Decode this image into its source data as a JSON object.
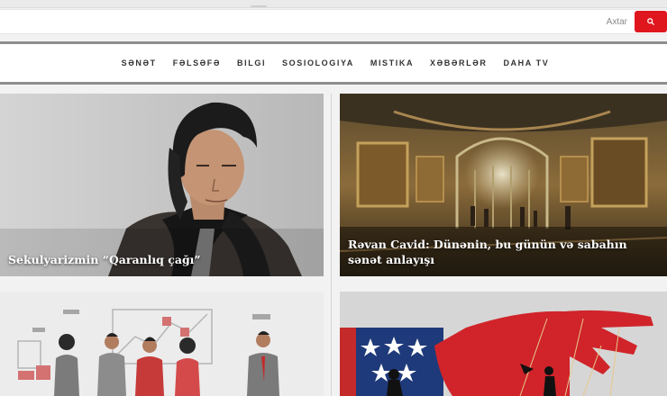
{
  "search": {
    "placeholder": "Axtar",
    "button_icon": "search-icon"
  },
  "nav": {
    "items": [
      "sənət",
      "fəlsəfə",
      "bilgi",
      "sosiologiya",
      "mistika",
      "xəbərlər",
      "daha tv"
    ]
  },
  "articles": [
    {
      "title": "Sekulyarizmin “Qaranlıq çağı”",
      "image": "portrait of man in black scarf"
    },
    {
      "title": "Rəvan Cavid: Dünənin, bu günün və sabahın sənət anlayışı",
      "image": "painting of a theater interior"
    },
    {
      "title": "",
      "image": "illustration of group of people"
    },
    {
      "title": "",
      "image": "red hand puppeteer over US flag"
    }
  ],
  "colors": {
    "accent": "#e0161e",
    "nav_border": "#8d8d8d"
  }
}
